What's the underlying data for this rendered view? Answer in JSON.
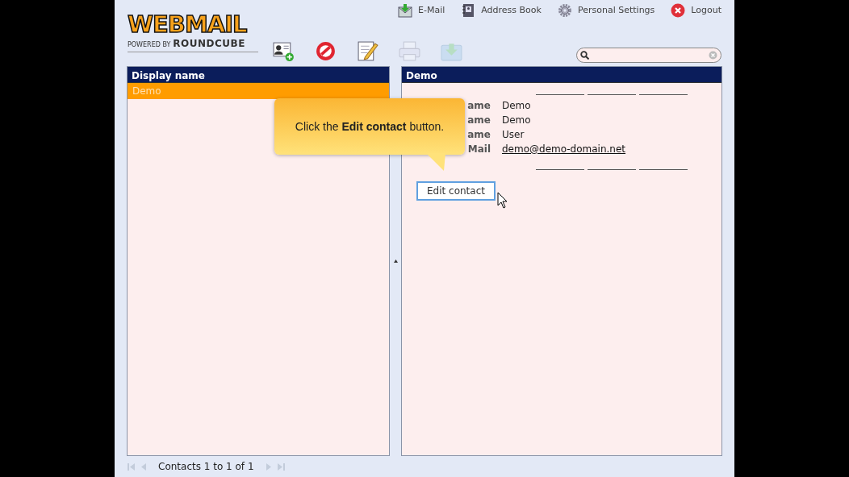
{
  "logo": {
    "title": "WEBMAIL",
    "tagline": "POWERED BY",
    "brand": "ROUNDCUBE"
  },
  "nav": [
    {
      "label": "E-Mail",
      "kind": "mail"
    },
    {
      "label": "Address Book",
      "kind": "book"
    },
    {
      "label": "Personal Settings",
      "kind": "gear"
    },
    {
      "label": "Logout",
      "kind": "logout"
    }
  ],
  "toolbar": [
    {
      "kind": "add",
      "disabled": false
    },
    {
      "kind": "delete",
      "disabled": false
    },
    {
      "kind": "edit",
      "disabled": false
    },
    {
      "kind": "print",
      "disabled": true
    },
    {
      "kind": "export",
      "disabled": true
    }
  ],
  "list": {
    "header": "Display name",
    "rows": [
      {
        "name": "Demo",
        "selected": true
      }
    ]
  },
  "contact": {
    "title": "Demo",
    "fields": [
      {
        "label": "ame",
        "value": "Demo",
        "kind": "text"
      },
      {
        "label": "ame",
        "value": "Demo",
        "kind": "text"
      },
      {
        "label": "ame",
        "value": "User",
        "kind": "text"
      },
      {
        "label": "Mail",
        "value": "demo@demo-domain.net",
        "kind": "link"
      }
    ],
    "button": "Edit contact"
  },
  "tooltip": {
    "text": "Click the **Edit contact** button."
  },
  "footer": {
    "text": "Contacts 1 to 1 of 1",
    "first_disabled": true,
    "prev_disabled": true,
    "next_disabled": true,
    "last_disabled": true
  }
}
